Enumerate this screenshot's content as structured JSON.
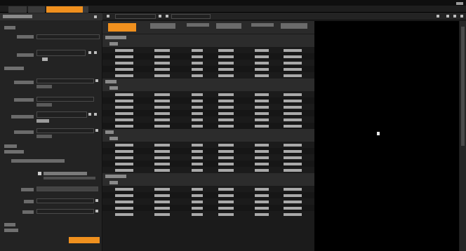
{
  "app": {
    "tabs": [
      {
        "label": "",
        "active": false
      },
      {
        "label": "",
        "active": false
      },
      {
        "label": "",
        "active": true
      }
    ],
    "colors": {
      "accent": "#f0901e",
      "background": "#1b1b1b",
      "panel": "#232323",
      "row_group": "#2c2c2c"
    }
  },
  "left_panel": {
    "title": "",
    "sections": [
      "",
      "",
      "",
      "",
      ""
    ],
    "fields": [
      {
        "label": "",
        "value": ""
      },
      {
        "label": "",
        "value": ""
      },
      {
        "label": "",
        "value": ""
      },
      {
        "label": "",
        "value": ""
      },
      {
        "label": "",
        "value": ""
      },
      {
        "label": "",
        "value": ""
      },
      {
        "label": "",
        "value": ""
      }
    ],
    "checkbox_label": "",
    "action_button": ""
  },
  "table": {
    "columns": [
      "",
      "",
      "",
      "",
      "",
      ""
    ],
    "groups": [
      {
        "label": "",
        "sub": "",
        "rows": 5
      },
      {
        "label": "",
        "sub": "",
        "rows": 6
      },
      {
        "label": "",
        "sub": "",
        "rows": 5
      },
      {
        "label": "",
        "sub": "",
        "rows": 5
      }
    ]
  }
}
